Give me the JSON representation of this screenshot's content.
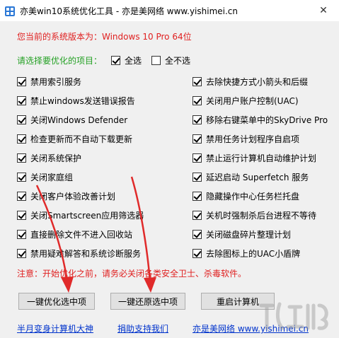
{
  "window": {
    "title": "亦美win10系统优化工具 - 亦是美网络 www.yishimei.cn",
    "close_glyph": "✕"
  },
  "header": {
    "version_text": "您当前的系统版本为：Windows 10 Pro  64位",
    "select_prompt": "请选择要优化的项目：",
    "select_all": {
      "label": "全选",
      "checked": true
    },
    "select_none": {
      "label": "全不选",
      "checked": false
    }
  },
  "options_left": [
    {
      "label": "禁用索引服务",
      "checked": true
    },
    {
      "label": "禁止windows发送错误报告",
      "checked": true
    },
    {
      "label": "关闭Windows Defender",
      "checked": true
    },
    {
      "label": "检查更新而不自动下载更新",
      "checked": true
    },
    {
      "label": "关闭系统保护",
      "checked": true
    },
    {
      "label": "关闭家庭组",
      "checked": true
    },
    {
      "label": "关闭客户体验改善计划",
      "checked": true
    },
    {
      "label": "关闭Smartscreen应用筛选器",
      "checked": true
    },
    {
      "label": "直接删除文件不进入回收站",
      "checked": true
    },
    {
      "label": "禁用疑难解答和系统诊断服务",
      "checked": true
    }
  ],
  "options_right": [
    {
      "label": "去除快捷方式小箭头和后缀",
      "checked": true
    },
    {
      "label": "关闭用户账户控制(UAC)",
      "checked": true
    },
    {
      "label": "移除右键菜单中的SkyDrive Pro",
      "checked": true
    },
    {
      "label": "禁用任务计划程序自启项",
      "checked": true
    },
    {
      "label": "禁止运行计算机自动维护计划",
      "checked": true
    },
    {
      "label": "延迟启动 Superfetch 服务",
      "checked": true
    },
    {
      "label": "隐藏操作中心任务栏托盘",
      "checked": true
    },
    {
      "label": "关机时强制杀后台进程不等待",
      "checked": true
    },
    {
      "label": "关闭磁盘碎片整理计划",
      "checked": true
    },
    {
      "label": "去除图标上的UAC小盾牌",
      "checked": true
    }
  ],
  "notice": "注意：开始优化之前，请务必关闭各类安全卫士、杀毒软件。",
  "buttons": {
    "optimize": "一键优化选中项",
    "restore": "一键还原选中项",
    "restart": "重启计算机"
  },
  "links": {
    "left": "半月变身计算机大神",
    "middle": "捐助支持我们",
    "right": "亦是美网络 www.yishimei.cn"
  },
  "colors": {
    "warning_red": "#e02020",
    "prompt_green": "#23a023",
    "link_blue": "#0033cc",
    "annotation_arrow": "#e02a2a"
  }
}
